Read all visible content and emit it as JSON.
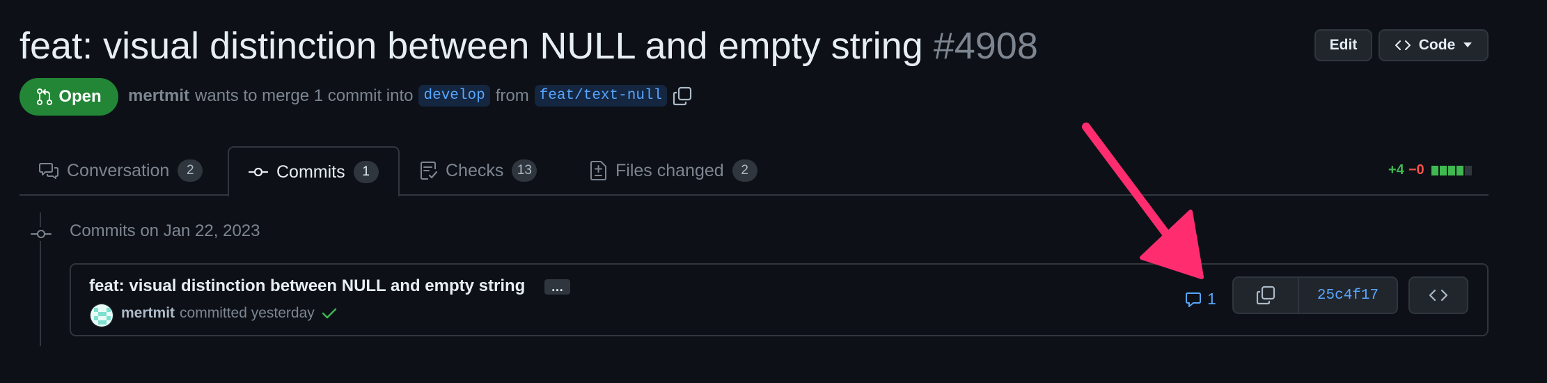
{
  "pr": {
    "title": "feat: visual distinction between NULL and empty string",
    "number": "#4908",
    "state": "Open",
    "author": "mertmit",
    "merge_text": "wants to merge 1 commit into",
    "base_branch": "develop",
    "from_text": "from",
    "head_branch": "feat/text-null"
  },
  "header_actions": {
    "edit_label": "Edit",
    "code_label": "Code"
  },
  "tabs": [
    {
      "label": "Conversation",
      "count": "2",
      "icon": "comment-discussion-icon"
    },
    {
      "label": "Commits",
      "count": "1",
      "icon": "git-commit-icon",
      "active": true
    },
    {
      "label": "Checks",
      "count": "13",
      "icon": "checklist-icon"
    },
    {
      "label": "Files changed",
      "count": "2",
      "icon": "file-diff-icon"
    }
  ],
  "diffstat": {
    "additions": "+4",
    "deletions": "−0"
  },
  "commits": {
    "date_heading": "Commits on Jan 22, 2023",
    "items": [
      {
        "message": "feat: visual distinction between NULL and empty string",
        "ellipsis": "…",
        "author": "mertmit",
        "action": "committed yesterday",
        "status": "success",
        "comment_count": "1",
        "sha": "25c4f17"
      }
    ]
  },
  "colors": {
    "background": "#0d1117",
    "open_green": "#238636",
    "link_blue": "#58a6ff",
    "annotation_arrow": "#ff2d6f"
  }
}
